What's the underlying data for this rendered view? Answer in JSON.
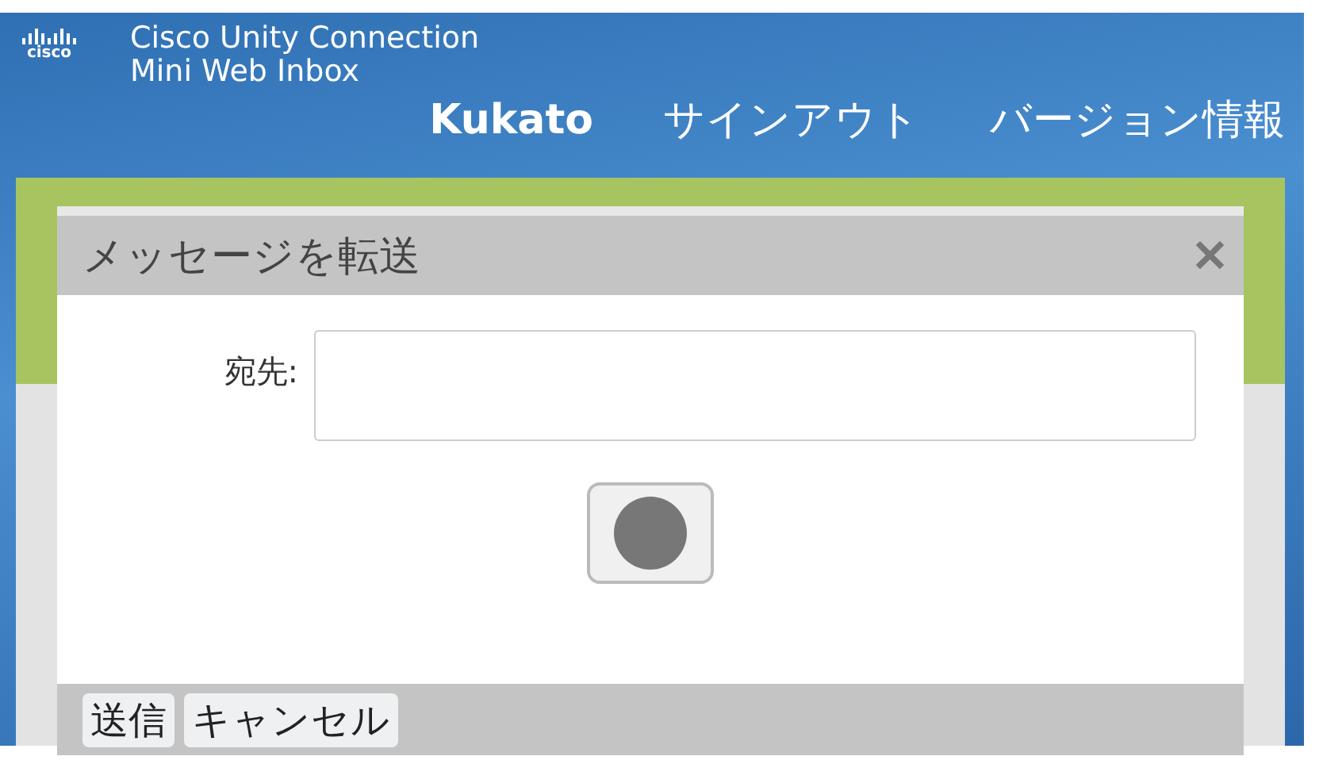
{
  "header": {
    "logo": "cisco",
    "product": "Cisco Unity Connection",
    "subtitle": "Mini Web Inbox",
    "user": "Kukato",
    "links": [
      "サインアウト",
      "バージョン情報"
    ]
  },
  "dialog": {
    "title": "メッセージを転送",
    "close": "✕",
    "to_label": "宛先:",
    "buttons": [
      "送信",
      "キャンセル"
    ]
  }
}
